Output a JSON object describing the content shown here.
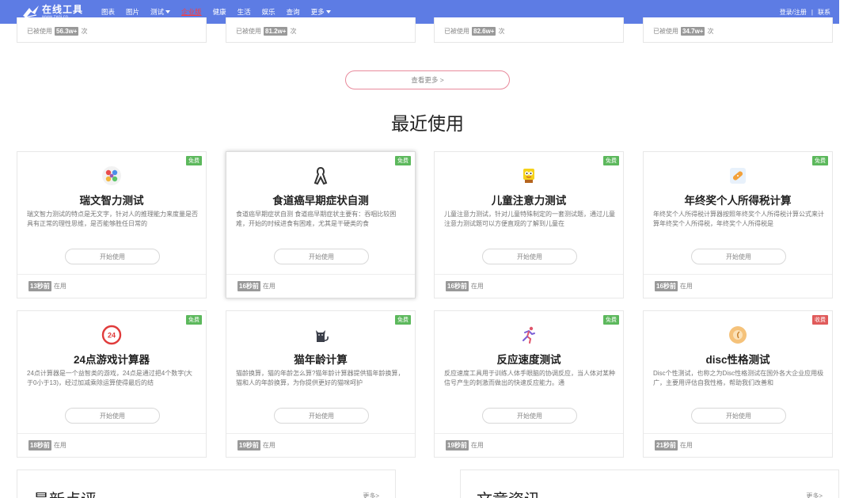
{
  "header": {
    "logo_title": "在线工具",
    "logo_url": "www.zxgj.cn",
    "nav": [
      {
        "label": "图表",
        "dropdown": false,
        "hot": false
      },
      {
        "label": "图片",
        "dropdown": false,
        "hot": false
      },
      {
        "label": "测试",
        "dropdown": true,
        "hot": false
      },
      {
        "label": "企业版",
        "dropdown": false,
        "hot": true
      },
      {
        "label": "健康",
        "dropdown": false,
        "hot": false
      },
      {
        "label": "生活",
        "dropdown": false,
        "hot": false
      },
      {
        "label": "娱乐",
        "dropdown": false,
        "hot": false
      },
      {
        "label": "查询",
        "dropdown": false,
        "hot": false
      },
      {
        "label": "更多",
        "dropdown": true,
        "hot": false
      }
    ],
    "login": "登录/注册",
    "contact": "联系"
  },
  "top_strip": [
    {
      "prefix": "已被使用",
      "count": "56.3w+",
      "suffix": "次"
    },
    {
      "prefix": "已被使用",
      "count": "81.2w+",
      "suffix": "次"
    },
    {
      "prefix": "已被使用",
      "count": "82.6w+",
      "suffix": "次"
    },
    {
      "prefix": "已被使用",
      "count": "34.7w+",
      "suffix": "次"
    }
  ],
  "see_more": "查看更多 >",
  "recent_title": "最近使用",
  "start_label": "开始使用",
  "in_use_label": "在用",
  "cards": [
    {
      "title": "瑞文智力测试",
      "price": "免费",
      "icon": "puzzle-icon",
      "desc": "瑞文智力测试的特点是无文字，针对人的推理能力来度量是否具有正常的理性思维，是否能够胜任日常的",
      "time": "13秒前"
    },
    {
      "title": "食道癌早期症状自测",
      "price": "免费",
      "icon": "ribbon-icon",
      "desc": "食道癌早期症状自测 食道癌早期症状主要有：吞咽比较困难，开始的时候进食有困难，尤其是干硬类的食",
      "time": "16秒前"
    },
    {
      "title": "儿童注意力测试",
      "price": "免费",
      "icon": "sponge-icon",
      "desc": "儿童注意力测试，针对儿童特殊制定的一套测试题，通过儿童注意力测试题可以方便直观的了解到儿童在",
      "time": "16秒前"
    },
    {
      "title": "年终奖个人所得税计算",
      "price": "免费",
      "icon": "bandage-icon",
      "desc": "年终奖个人所得税计算器按照年终奖个人所得税计算公式来计算年终奖个人所得税，年终奖个人所得税是",
      "time": "16秒前"
    },
    {
      "title": "24点游戏计算器",
      "price": "免费",
      "icon": "clock-24-icon",
      "desc": "24点计算器是一个益智类的游戏，24点是通过把4个数字(大于0小于13)，经过加减乘除运算使得最后的结",
      "time": "18秒前"
    },
    {
      "title": "猫年龄计算",
      "price": "免费",
      "icon": "cat-icon",
      "desc": "猫龄换算，猫的年龄怎么算?猫年龄计算器提供猫年龄换算，猫和人的年龄换算，为你提供更好的猫咪呵护",
      "time": "19秒前"
    },
    {
      "title": "反应速度测试",
      "price": "免费",
      "icon": "runner-icon",
      "desc": "反应速度工具用于训练人体手眼脑的协调反应，当人体对某种信号产生的刺激而做出的快速反应能力。通",
      "time": "19秒前"
    },
    {
      "title": "disc性格测试",
      "price": "收费",
      "icon": "disc-icon",
      "desc": "Disc个性测试，也称之为Disc性格测试在国外各大企业应用极广，主要用评估自我性格，帮助我们改善和",
      "time": "21秒前"
    }
  ],
  "bottom": [
    {
      "title": "最新点评",
      "more": "更多>"
    },
    {
      "title": "文章资讯",
      "more": "更多>"
    }
  ],
  "colors": {
    "header": "#5d7ce4",
    "free": "#5cb85c",
    "paid": "#e05a5a",
    "see_more_border": "#e88a9c"
  }
}
